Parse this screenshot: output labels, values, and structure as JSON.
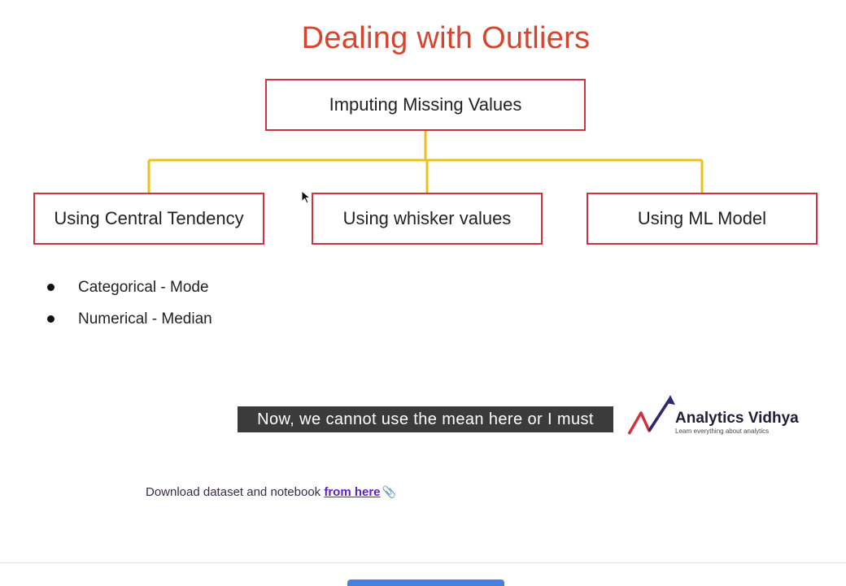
{
  "slide": {
    "title": "Dealing with Outliers",
    "title_color": "#d6452f",
    "box_border_color": "#d2313f",
    "connector_color": "#e8c21a",
    "root_box": "Imputing Missing Values",
    "children": [
      "Using Central Tendency",
      "Using whisker values",
      "Using ML Model"
    ],
    "bullets": [
      "Categorical - Mode",
      "Numerical - Median"
    ]
  },
  "video": {
    "caption": "Now, we cannot use the mean here or I must"
  },
  "brand": {
    "name": "Analytics Vidhya",
    "tagline": "Learn everything about analytics"
  },
  "download": {
    "text": "Download dataset and notebook ",
    "link_label": "from here",
    "icon": "paperclip-icon"
  }
}
